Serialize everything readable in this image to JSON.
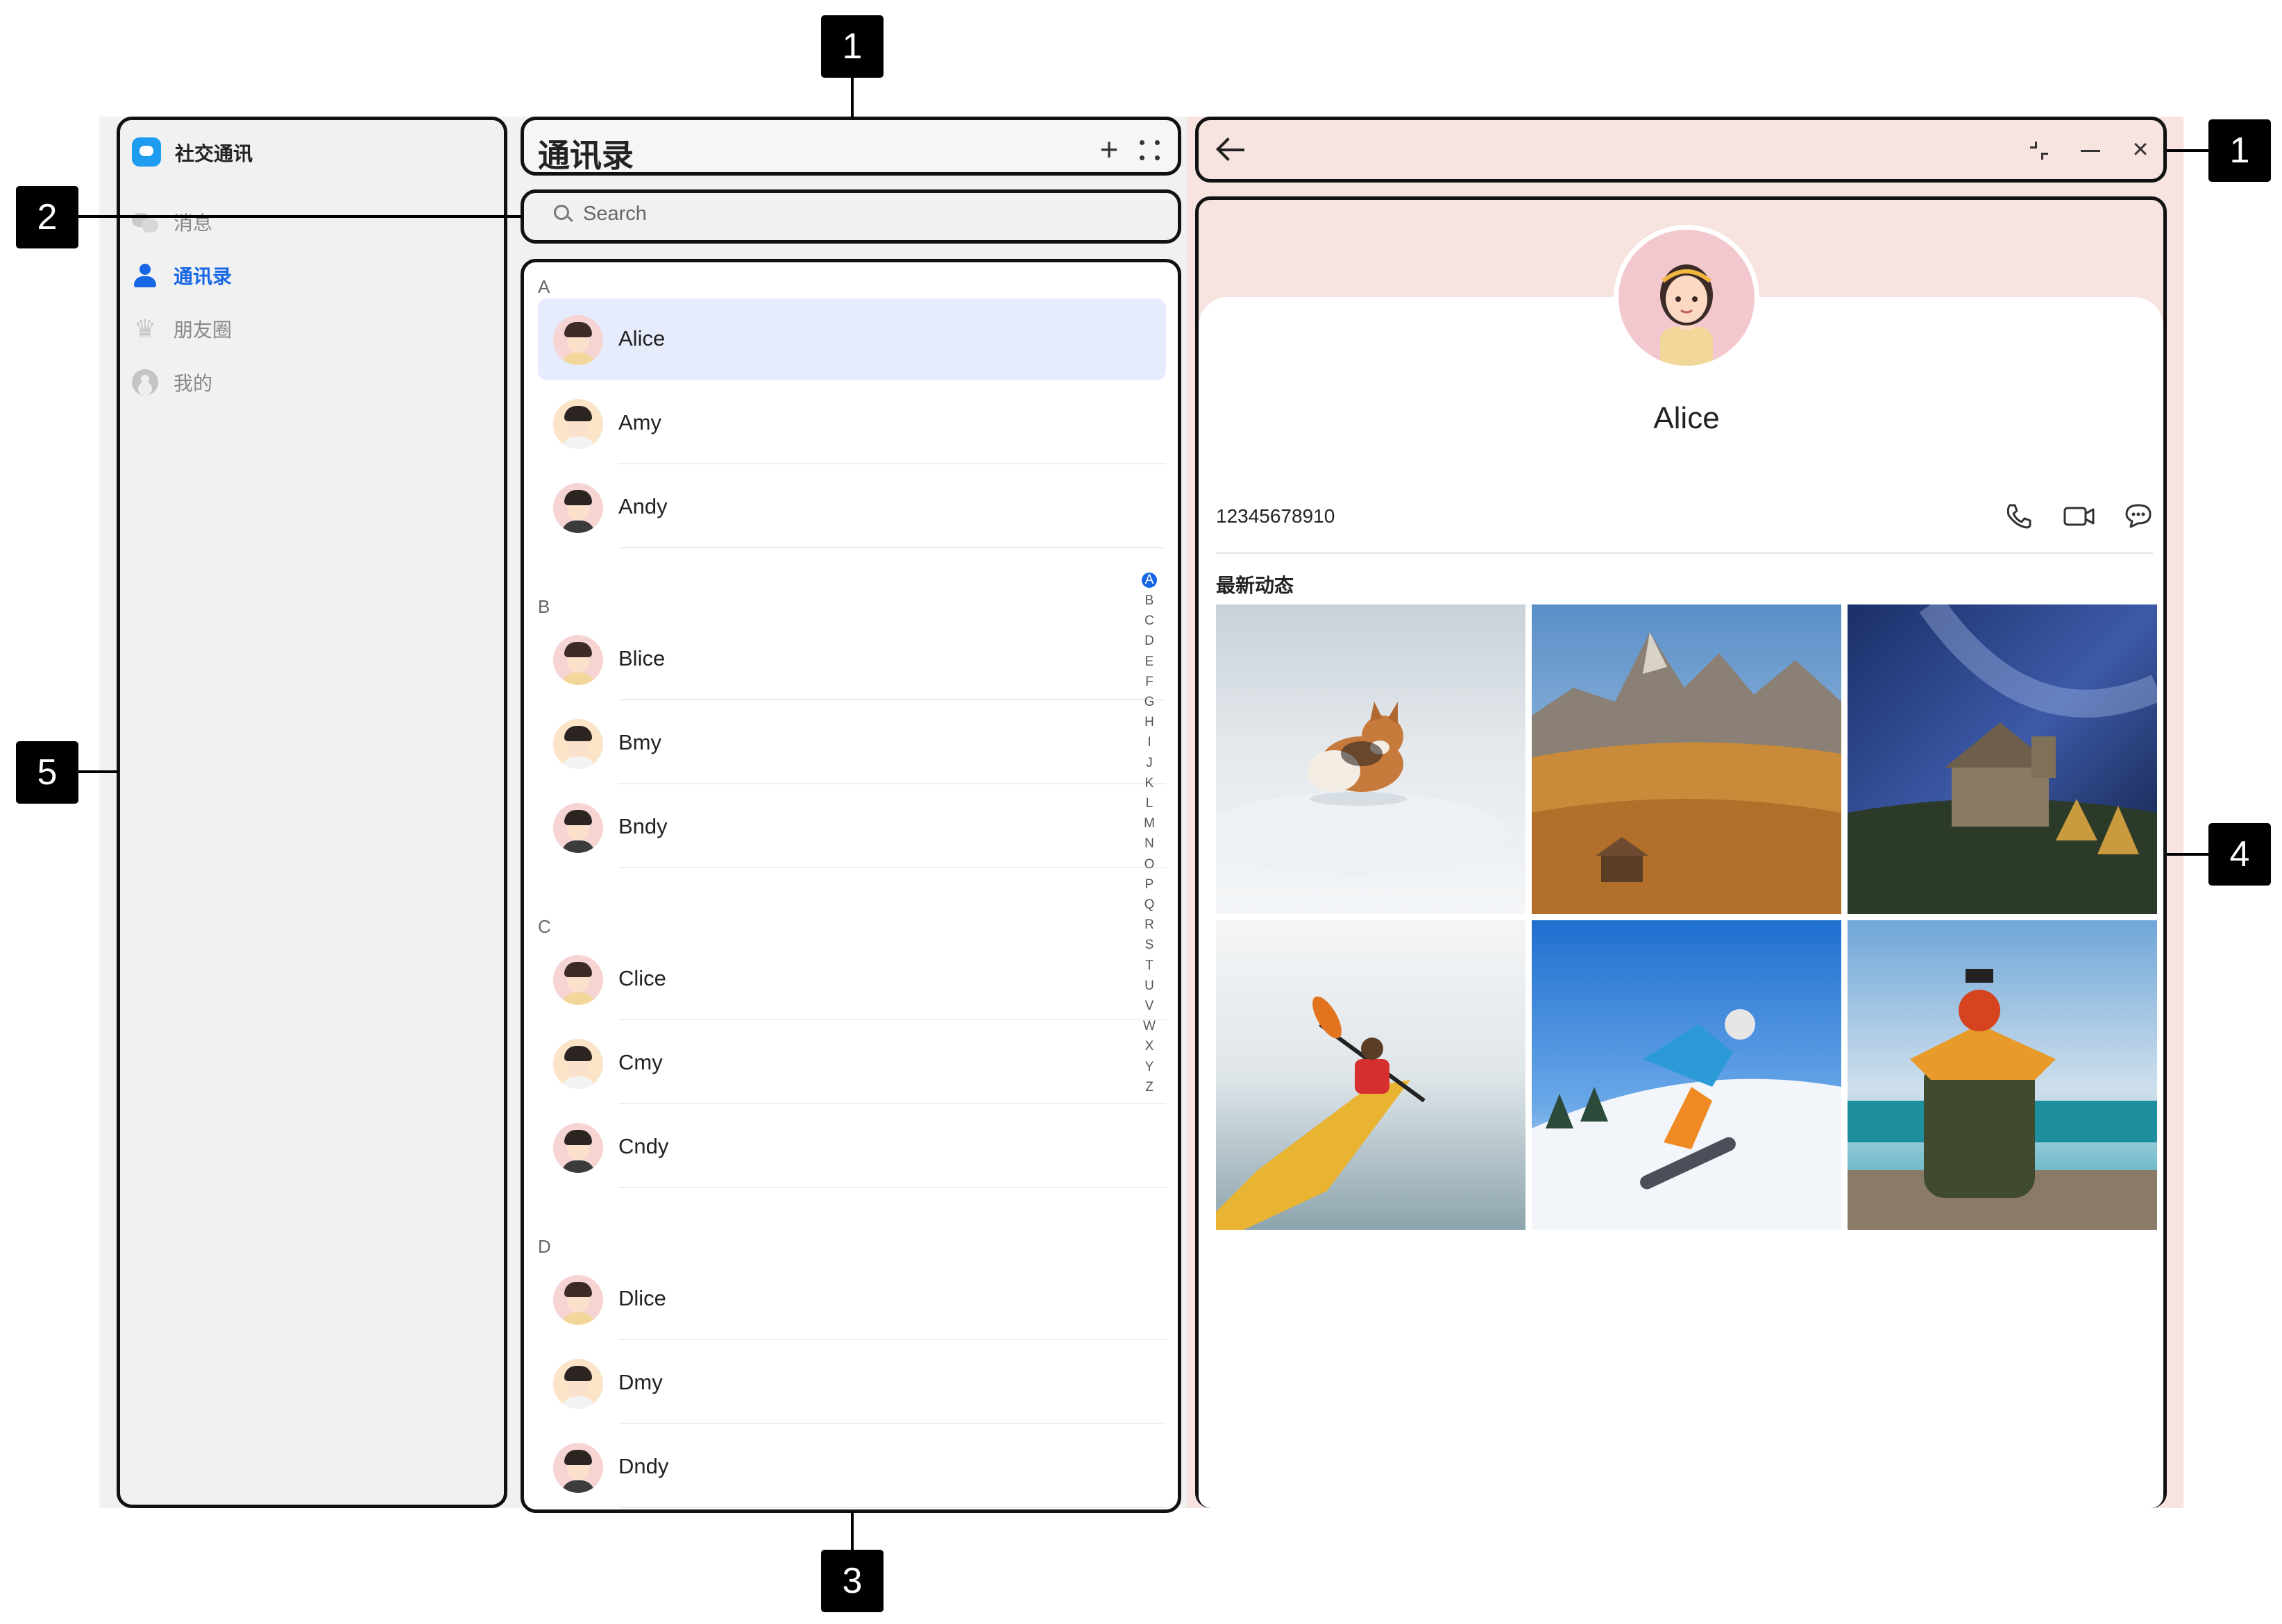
{
  "app": {
    "title": "社交通讯",
    "nav": [
      {
        "label": "消息",
        "icon": "chat-bubbles-icon",
        "active": false
      },
      {
        "label": "通讯录",
        "icon": "contacts-icon",
        "active": true
      },
      {
        "label": "朋友圈",
        "icon": "moments-crown-icon",
        "active": false
      },
      {
        "label": "我的",
        "icon": "profile-icon",
        "active": false
      }
    ]
  },
  "list_header": {
    "title": "通讯录",
    "add_icon": "plus-icon",
    "more_icon": "grid-dots-icon"
  },
  "search": {
    "placeholder": "Search"
  },
  "contacts": {
    "sections": [
      {
        "letter": "A",
        "items": [
          "Alice",
          "Amy",
          "Andy"
        ]
      },
      {
        "letter": "B",
        "items": [
          "Blice",
          "Bmy",
          "Bndy"
        ]
      },
      {
        "letter": "C",
        "items": [
          "Clice",
          "Cmy",
          "Cndy"
        ]
      },
      {
        "letter": "D",
        "items": [
          "Dlice",
          "Dmy",
          "Dndy"
        ]
      }
    ],
    "selected": "Alice",
    "alpha_index": [
      "A",
      "B",
      "C",
      "D",
      "E",
      "F",
      "G",
      "H",
      "I",
      "J",
      "K",
      "L",
      "M",
      "N",
      "O",
      "P",
      "Q",
      "R",
      "S",
      "T",
      "U",
      "V",
      "W",
      "X",
      "Y",
      "Z"
    ],
    "alpha_active": "A"
  },
  "detail": {
    "back_icon": "back-arrow-icon",
    "window_controls": [
      "restore-icon",
      "minimize-icon",
      "close-icon"
    ],
    "name": "Alice",
    "phone": "12345678910",
    "actions": [
      "phone-icon",
      "video-call-icon",
      "message-icon"
    ],
    "moments_title": "最新动态",
    "photos": [
      "corgi-in-snow",
      "mountains-meadow",
      "stone-church-milky-way",
      "kayaker",
      "snowboarder",
      "traveler-taking-photo"
    ]
  },
  "callouts": {
    "top_middle": "1",
    "top_right": "1",
    "search": "2",
    "list_bottom": "3",
    "detail": "4",
    "sidebar": "5"
  },
  "colors": {
    "accent": "#1766e6",
    "selected_row": "#e6ecfb",
    "detail_tint": "#f7e3df",
    "panel_bg": "#f1f1f1"
  }
}
